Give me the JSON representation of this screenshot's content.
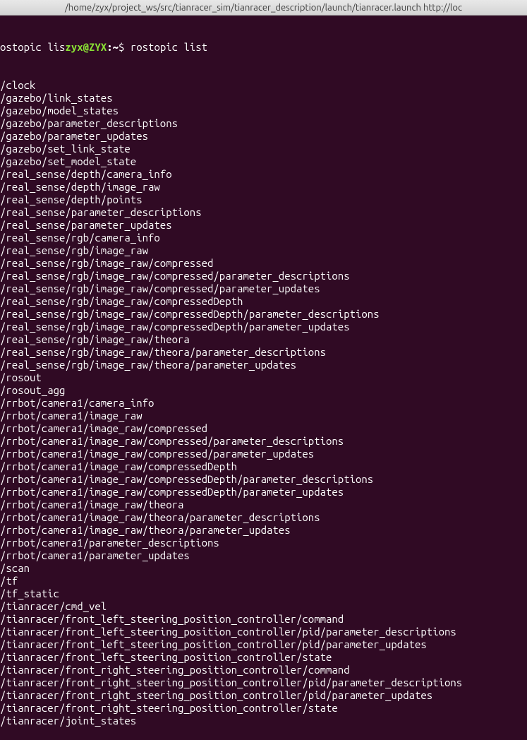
{
  "title_bar": "/home/zyx/project_ws/src/tianracer_sim/tianracer_description/launch/tianracer.launch http://loc",
  "prompt": {
    "prefix": "ostopic lis",
    "user_host": "zyx@ZYX",
    "path": ":~",
    "dollar": "$ ",
    "command": "rostopic list"
  },
  "topics": [
    "/clock",
    "/gazebo/link_states",
    "/gazebo/model_states",
    "/gazebo/parameter_descriptions",
    "/gazebo/parameter_updates",
    "/gazebo/set_link_state",
    "/gazebo/set_model_state",
    "/real_sense/depth/camera_info",
    "/real_sense/depth/image_raw",
    "/real_sense/depth/points",
    "/real_sense/parameter_descriptions",
    "/real_sense/parameter_updates",
    "/real_sense/rgb/camera_info",
    "/real_sense/rgb/image_raw",
    "/real_sense/rgb/image_raw/compressed",
    "/real_sense/rgb/image_raw/compressed/parameter_descriptions",
    "/real_sense/rgb/image_raw/compressed/parameter_updates",
    "/real_sense/rgb/image_raw/compressedDepth",
    "/real_sense/rgb/image_raw/compressedDepth/parameter_descriptions",
    "/real_sense/rgb/image_raw/compressedDepth/parameter_updates",
    "/real_sense/rgb/image_raw/theora",
    "/real_sense/rgb/image_raw/theora/parameter_descriptions",
    "/real_sense/rgb/image_raw/theora/parameter_updates",
    "/rosout",
    "/rosout_agg",
    "/rrbot/camera1/camera_info",
    "/rrbot/camera1/image_raw",
    "/rrbot/camera1/image_raw/compressed",
    "/rrbot/camera1/image_raw/compressed/parameter_descriptions",
    "/rrbot/camera1/image_raw/compressed/parameter_updates",
    "/rrbot/camera1/image_raw/compressedDepth",
    "/rrbot/camera1/image_raw/compressedDepth/parameter_descriptions",
    "/rrbot/camera1/image_raw/compressedDepth/parameter_updates",
    "/rrbot/camera1/image_raw/theora",
    "/rrbot/camera1/image_raw/theora/parameter_descriptions",
    "/rrbot/camera1/image_raw/theora/parameter_updates",
    "/rrbot/camera1/parameter_descriptions",
    "/rrbot/camera1/parameter_updates",
    "/scan",
    "/tf",
    "/tf_static",
    "/tianracer/cmd_vel",
    "/tianracer/front_left_steering_position_controller/command",
    "/tianracer/front_left_steering_position_controller/pid/parameter_descriptions",
    "/tianracer/front_left_steering_position_controller/pid/parameter_updates",
    "/tianracer/front_left_steering_position_controller/state",
    "/tianracer/front_right_steering_position_controller/command",
    "/tianracer/front_right_steering_position_controller/pid/parameter_descriptions",
    "/tianracer/front_right_steering_position_controller/pid/parameter_updates",
    "/tianracer/front_right_steering_position_controller/state",
    "/tianracer/joint_states"
  ]
}
